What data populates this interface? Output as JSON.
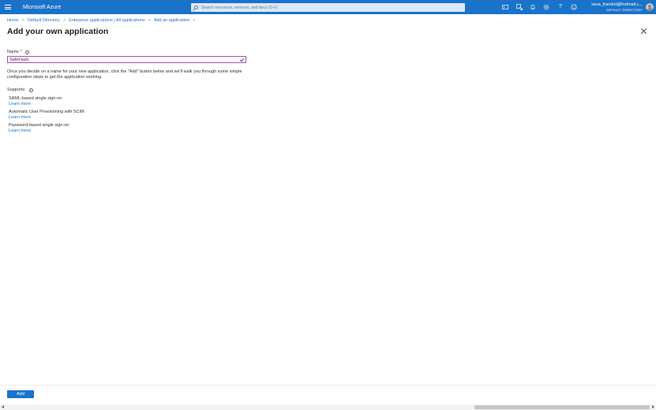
{
  "topbar": {
    "brand": "Microsoft Azure",
    "search_placeholder": "Search resources, services, and docs (G+/)",
    "user_email": "seza_frandoli@hotmail.c...",
    "user_directory": "DEFAULT DIRECTORY",
    "icons": [
      "cloud-shell-icon",
      "directory-filter-icon",
      "notifications-icon",
      "settings-icon",
      "help-icon",
      "feedback-icon"
    ]
  },
  "breadcrumb": {
    "items": [
      "Home",
      "Default Directory",
      "Enterprise applications | All applications",
      "Add an application"
    ]
  },
  "page": {
    "title": "Add your own application"
  },
  "form": {
    "name_label": "Name",
    "name_required": "*",
    "name_value": "SafeFaaS",
    "description": "Once you decide on a name for your new application, click the \"Add\" button below and we'll walk you through some simple configuration steps to get the application working.",
    "supports_label": "Supports:",
    "features": [
      {
        "name": "SAML-based single sign-on",
        "link": "Learn more"
      },
      {
        "name": "Automatic User Provisioning with SCIM",
        "link": "Learn more"
      },
      {
        "name": "Password-based single sign-on",
        "link": "Learn more"
      }
    ]
  },
  "footer": {
    "add_label": "Add"
  }
}
